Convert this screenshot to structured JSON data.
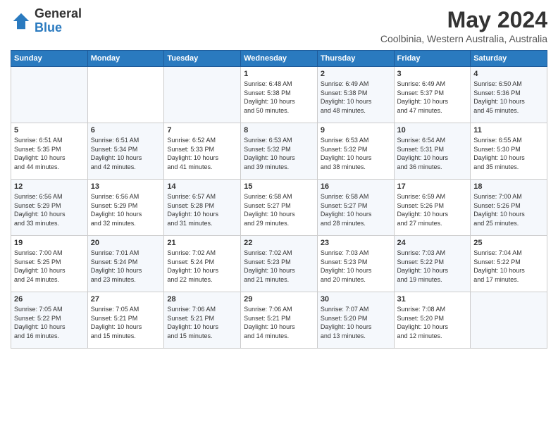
{
  "logo": {
    "general": "General",
    "blue": "Blue"
  },
  "title": {
    "month": "May 2024",
    "location": "Coolbinia, Western Australia, Australia"
  },
  "headers": [
    "Sunday",
    "Monday",
    "Tuesday",
    "Wednesday",
    "Thursday",
    "Friday",
    "Saturday"
  ],
  "weeks": [
    [
      {
        "day": "",
        "info": ""
      },
      {
        "day": "",
        "info": ""
      },
      {
        "day": "",
        "info": ""
      },
      {
        "day": "1",
        "info": "Sunrise: 6:48 AM\nSunset: 5:38 PM\nDaylight: 10 hours\nand 50 minutes."
      },
      {
        "day": "2",
        "info": "Sunrise: 6:49 AM\nSunset: 5:38 PM\nDaylight: 10 hours\nand 48 minutes."
      },
      {
        "day": "3",
        "info": "Sunrise: 6:49 AM\nSunset: 5:37 PM\nDaylight: 10 hours\nand 47 minutes."
      },
      {
        "day": "4",
        "info": "Sunrise: 6:50 AM\nSunset: 5:36 PM\nDaylight: 10 hours\nand 45 minutes."
      }
    ],
    [
      {
        "day": "5",
        "info": "Sunrise: 6:51 AM\nSunset: 5:35 PM\nDaylight: 10 hours\nand 44 minutes."
      },
      {
        "day": "6",
        "info": "Sunrise: 6:51 AM\nSunset: 5:34 PM\nDaylight: 10 hours\nand 42 minutes."
      },
      {
        "day": "7",
        "info": "Sunrise: 6:52 AM\nSunset: 5:33 PM\nDaylight: 10 hours\nand 41 minutes."
      },
      {
        "day": "8",
        "info": "Sunrise: 6:53 AM\nSunset: 5:32 PM\nDaylight: 10 hours\nand 39 minutes."
      },
      {
        "day": "9",
        "info": "Sunrise: 6:53 AM\nSunset: 5:32 PM\nDaylight: 10 hours\nand 38 minutes."
      },
      {
        "day": "10",
        "info": "Sunrise: 6:54 AM\nSunset: 5:31 PM\nDaylight: 10 hours\nand 36 minutes."
      },
      {
        "day": "11",
        "info": "Sunrise: 6:55 AM\nSunset: 5:30 PM\nDaylight: 10 hours\nand 35 minutes."
      }
    ],
    [
      {
        "day": "12",
        "info": "Sunrise: 6:56 AM\nSunset: 5:29 PM\nDaylight: 10 hours\nand 33 minutes."
      },
      {
        "day": "13",
        "info": "Sunrise: 6:56 AM\nSunset: 5:29 PM\nDaylight: 10 hours\nand 32 minutes."
      },
      {
        "day": "14",
        "info": "Sunrise: 6:57 AM\nSunset: 5:28 PM\nDaylight: 10 hours\nand 31 minutes."
      },
      {
        "day": "15",
        "info": "Sunrise: 6:58 AM\nSunset: 5:27 PM\nDaylight: 10 hours\nand 29 minutes."
      },
      {
        "day": "16",
        "info": "Sunrise: 6:58 AM\nSunset: 5:27 PM\nDaylight: 10 hours\nand 28 minutes."
      },
      {
        "day": "17",
        "info": "Sunrise: 6:59 AM\nSunset: 5:26 PM\nDaylight: 10 hours\nand 27 minutes."
      },
      {
        "day": "18",
        "info": "Sunrise: 7:00 AM\nSunset: 5:26 PM\nDaylight: 10 hours\nand 25 minutes."
      }
    ],
    [
      {
        "day": "19",
        "info": "Sunrise: 7:00 AM\nSunset: 5:25 PM\nDaylight: 10 hours\nand 24 minutes."
      },
      {
        "day": "20",
        "info": "Sunrise: 7:01 AM\nSunset: 5:24 PM\nDaylight: 10 hours\nand 23 minutes."
      },
      {
        "day": "21",
        "info": "Sunrise: 7:02 AM\nSunset: 5:24 PM\nDaylight: 10 hours\nand 22 minutes."
      },
      {
        "day": "22",
        "info": "Sunrise: 7:02 AM\nSunset: 5:23 PM\nDaylight: 10 hours\nand 21 minutes."
      },
      {
        "day": "23",
        "info": "Sunrise: 7:03 AM\nSunset: 5:23 PM\nDaylight: 10 hours\nand 20 minutes."
      },
      {
        "day": "24",
        "info": "Sunrise: 7:03 AM\nSunset: 5:22 PM\nDaylight: 10 hours\nand 19 minutes."
      },
      {
        "day": "25",
        "info": "Sunrise: 7:04 AM\nSunset: 5:22 PM\nDaylight: 10 hours\nand 17 minutes."
      }
    ],
    [
      {
        "day": "26",
        "info": "Sunrise: 7:05 AM\nSunset: 5:22 PM\nDaylight: 10 hours\nand 16 minutes."
      },
      {
        "day": "27",
        "info": "Sunrise: 7:05 AM\nSunset: 5:21 PM\nDaylight: 10 hours\nand 15 minutes."
      },
      {
        "day": "28",
        "info": "Sunrise: 7:06 AM\nSunset: 5:21 PM\nDaylight: 10 hours\nand 15 minutes."
      },
      {
        "day": "29",
        "info": "Sunrise: 7:06 AM\nSunset: 5:21 PM\nDaylight: 10 hours\nand 14 minutes."
      },
      {
        "day": "30",
        "info": "Sunrise: 7:07 AM\nSunset: 5:20 PM\nDaylight: 10 hours\nand 13 minutes."
      },
      {
        "day": "31",
        "info": "Sunrise: 7:08 AM\nSunset: 5:20 PM\nDaylight: 10 hours\nand 12 minutes."
      },
      {
        "day": "",
        "info": ""
      }
    ]
  ]
}
